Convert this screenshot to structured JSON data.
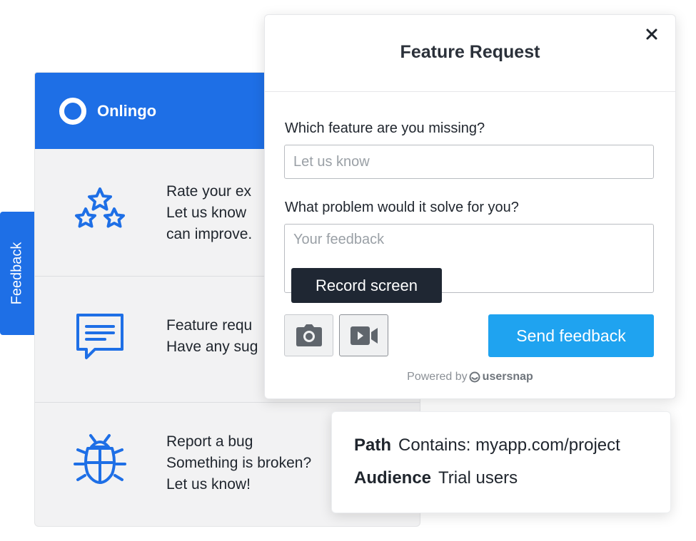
{
  "menu": {
    "brand": "Onlingo",
    "items": [
      {
        "icon": "stars-icon",
        "lines": [
          "Rate your ex",
          "Let us know",
          "can improve."
        ]
      },
      {
        "icon": "chat-icon",
        "lines": [
          "Feature requ",
          "Have any sug"
        ]
      },
      {
        "icon": "bug-icon",
        "lines": [
          "Report a bug",
          "Something is broken?",
          "Let us know!"
        ]
      }
    ]
  },
  "side_tab": {
    "label": "Feedback"
  },
  "modal": {
    "title": "Feature Request",
    "close_icon": "close-icon",
    "field1": {
      "label": "Which feature are you missing?",
      "placeholder": "Let us know"
    },
    "field2": {
      "label": "What problem would it solve for you?",
      "placeholder": "Your feedback"
    },
    "tooltip": "Record screen",
    "screenshot_icon": "camera-icon",
    "record_icon": "video-camera-icon",
    "send_label": "Send feedback",
    "powered_by": "Powered by",
    "powered_brand": "usersnap"
  },
  "targeting": {
    "path_label": "Path",
    "path_value": "Contains: myapp.com/project",
    "audience_label": "Audience",
    "audience_value": "Trial users"
  },
  "colors": {
    "brand_blue": "#1e6fe6",
    "send_blue": "#1fa3f0",
    "tooltip_dark": "#1f2733"
  }
}
